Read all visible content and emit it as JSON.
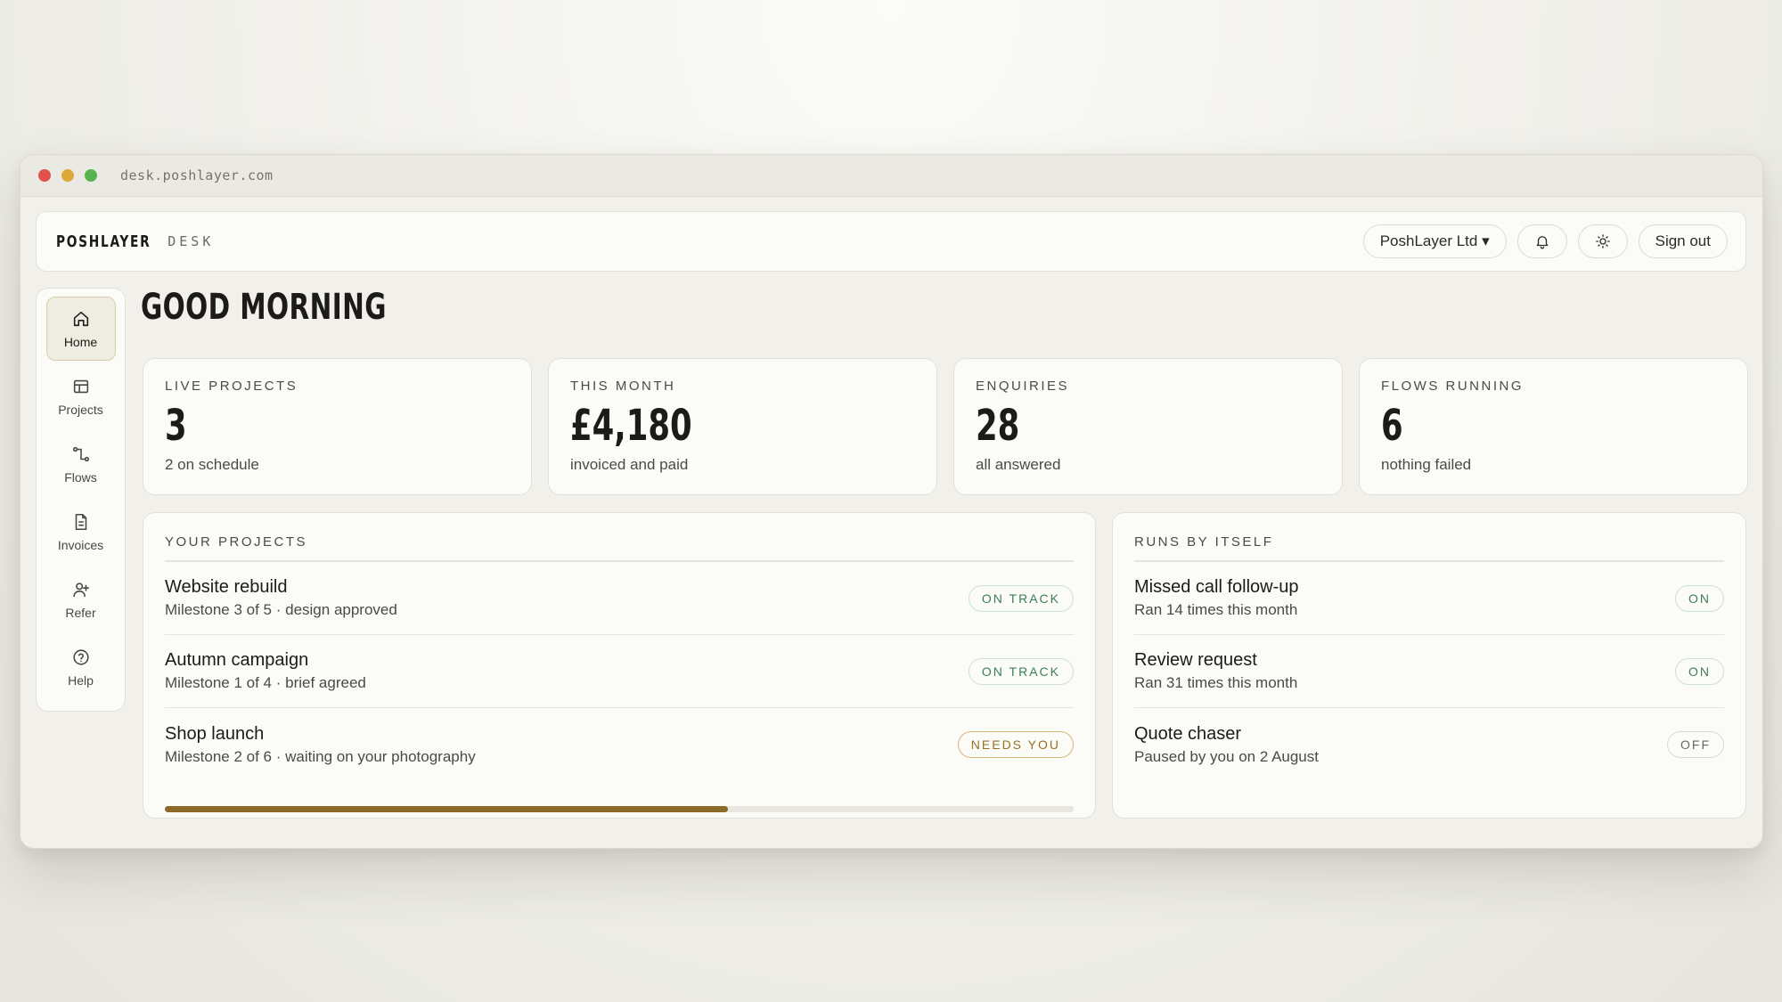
{
  "browser": {
    "url": "desk.poshlayer.com"
  },
  "header": {
    "brand": "POSHLAYER",
    "brand_sub": "DESK",
    "company": "PoshLayer Ltd ▾",
    "sign_out": "Sign out",
    "icons": [
      "bell-icon",
      "sun-icon"
    ]
  },
  "sidebar": {
    "items": [
      {
        "label": "Home",
        "icon": "home-icon",
        "active": true
      },
      {
        "label": "Projects",
        "icon": "table-icon"
      },
      {
        "label": "Flows",
        "icon": "flow-icon"
      },
      {
        "label": "Invoices",
        "icon": "document-icon"
      },
      {
        "label": "Refer",
        "icon": "add-user-icon"
      },
      {
        "label": "Help",
        "icon": "help-icon"
      }
    ]
  },
  "main": {
    "greeting": "GOOD MORNING",
    "stats": [
      {
        "label": "LIVE PROJECTS",
        "value": "3",
        "sub": "2 on schedule"
      },
      {
        "label": "THIS MONTH",
        "value": "£4,180",
        "sub": "invoiced and paid"
      },
      {
        "label": "ENQUIRIES",
        "value": "28",
        "sub": "all answered"
      },
      {
        "label": "FLOWS RUNNING",
        "value": "6",
        "sub": "nothing failed"
      }
    ],
    "projects": {
      "title": "YOUR PROJECTS",
      "rows": [
        {
          "name": "Website rebuild",
          "detail": "Milestone 3 of 5 · design approved",
          "status": "ON TRACK"
        },
        {
          "name": "Autumn campaign",
          "detail": "Milestone 1 of 4 · brief agreed",
          "status": "ON TRACK"
        },
        {
          "name": "Shop launch",
          "detail": "Milestone 2 of 6 · waiting on your photography",
          "status": "NEEDS YOU"
        }
      ],
      "progress_fraction": 0.62
    },
    "automations": {
      "title": "RUNS BY ITSELF",
      "rows": [
        {
          "name": "Missed call follow-up",
          "detail": "Ran 14 times this month",
          "state": "ON"
        },
        {
          "name": "Review request",
          "detail": "Ran 31 times this month",
          "state": "ON"
        },
        {
          "name": "Quote chaser",
          "detail": "Paused by you on 2 August",
          "state": "OFF"
        }
      ]
    }
  },
  "colors": {
    "accent": "#8a6a26",
    "on_track": "#3e7d56",
    "needs_you": "#9a6f22"
  }
}
